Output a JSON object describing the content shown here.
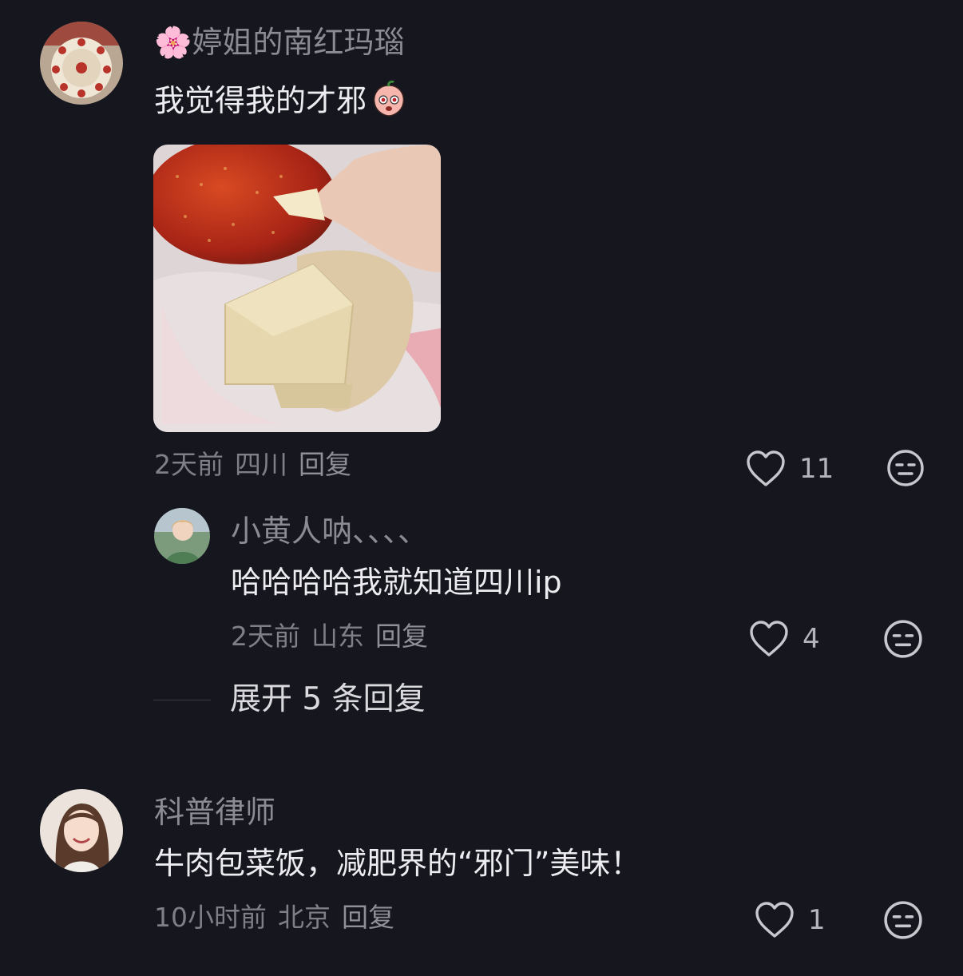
{
  "comments": [
    {
      "avatar_icon": "porcelain-plate-avatar",
      "username_emoji": "🌸",
      "username": "婷姐的南红玛瑙",
      "text": "我觉得我的才邪",
      "emoji_icon": "peach-face-emoji",
      "image_icon": "tofu-chili-photo",
      "time": "2天前",
      "location": "四川",
      "reply_label": "回复",
      "likes": "11"
    },
    {
      "avatar_icon": "girl-portrait-avatar",
      "username": "小黄人呐、、、、",
      "text": "哈哈哈哈我就知道四川ip",
      "time": "2天前",
      "location": "山东",
      "reply_label": "回复",
      "likes": "4"
    },
    {
      "avatar_icon": "smiling-woman-avatar",
      "username": "科普律师",
      "text": "牛肉包菜饭，减肥界的“邪门”美味！",
      "time": "10小时前",
      "location": "北京",
      "reply_label": "回复",
      "likes": "1"
    }
  ],
  "expand_replies_label": "展开 5 条回复",
  "colors": {
    "background": "#16161e",
    "username": "#8b8b93",
    "text": "#ececf1",
    "meta": "#7f7f88"
  }
}
